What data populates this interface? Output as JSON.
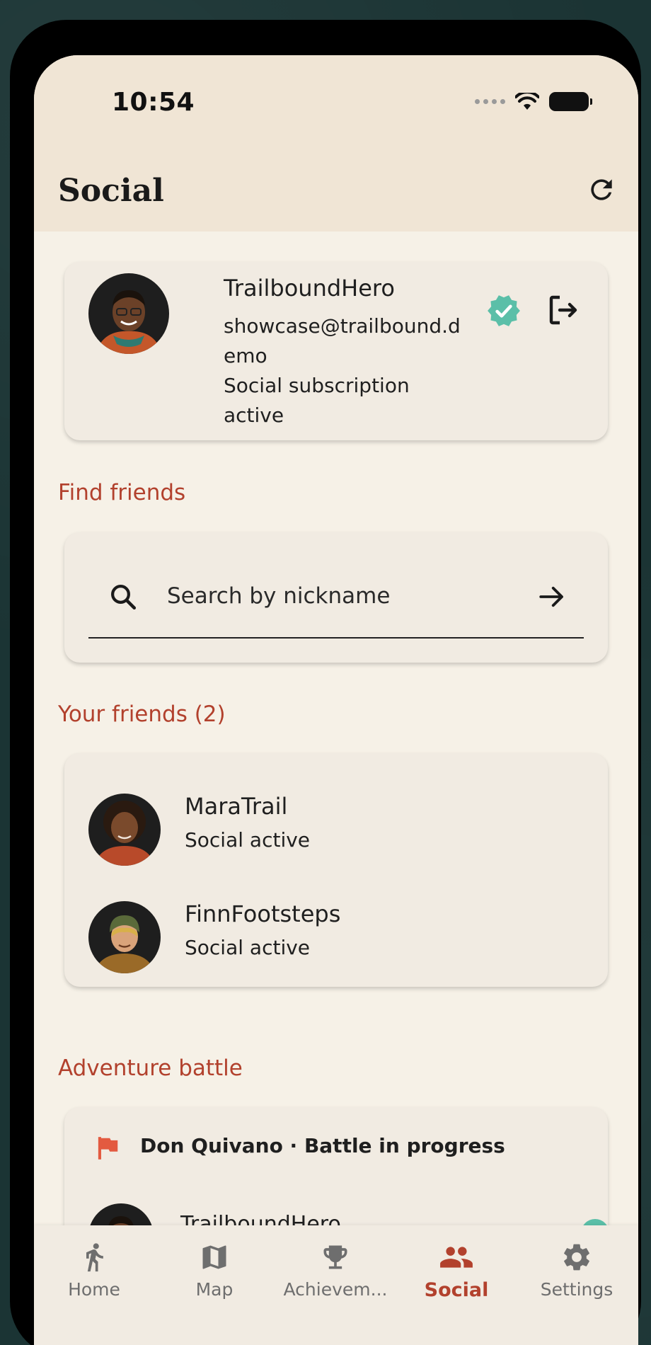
{
  "status_bar": {
    "time": "10:54"
  },
  "header": {
    "title": "Social",
    "refresh_icon": "refresh-icon"
  },
  "profile": {
    "name": "TrailboundHero",
    "email": "showcase@trailbound.demo",
    "subscription": "Social subscription active",
    "verified_icon": "verified-badge-icon",
    "logout_icon": "logout-icon",
    "accent": "#5bbfa8"
  },
  "find_friends": {
    "section_title": "Find friends",
    "placeholder": "Search by nickname"
  },
  "friends": {
    "section_title": "Your friends (2)",
    "items": [
      {
        "name": "MaraTrail",
        "status": "Social active"
      },
      {
        "name": "FinnFootsteps",
        "status": "Social active"
      }
    ]
  },
  "battle": {
    "section_title": "Adventure battle",
    "title": "Don Quivano · Battle in progress",
    "player": "TrailboundHero"
  },
  "nav": {
    "items": [
      {
        "label": "Home",
        "icon": "walking-icon"
      },
      {
        "label": "Map",
        "icon": "map-icon"
      },
      {
        "label": "Achievem...",
        "icon": "trophy-icon"
      },
      {
        "label": "Social",
        "icon": "people-icon"
      },
      {
        "label": "Settings",
        "icon": "gear-icon"
      }
    ],
    "active": "Social"
  },
  "colors": {
    "accent": "#b2412d",
    "header_bg": "#f0e5d5",
    "screen_bg": "#f6f1e7"
  }
}
